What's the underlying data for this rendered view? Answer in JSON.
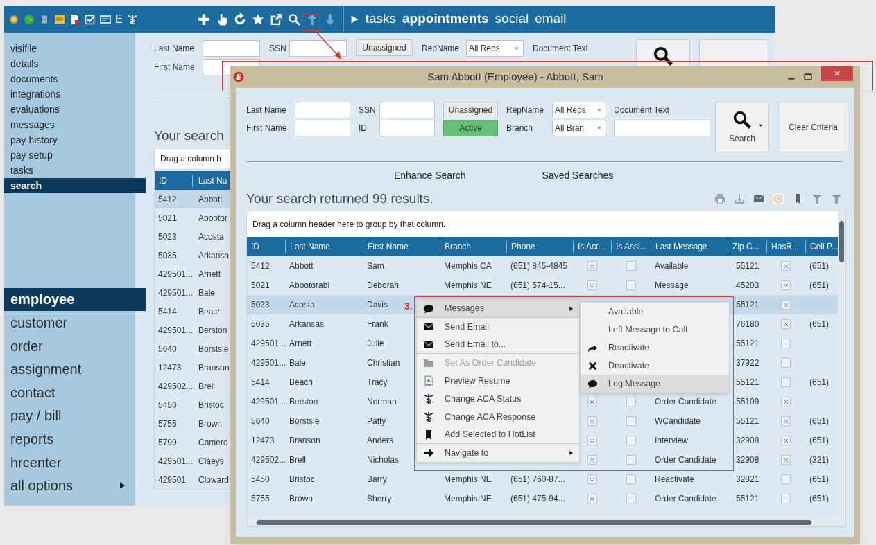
{
  "app": {
    "toolbar_letter": "E",
    "nav_links": [
      "tasks",
      "appointments",
      "social",
      "email"
    ],
    "sidebar_items": [
      {
        "label": "visifile",
        "selected": false
      },
      {
        "label": "details",
        "selected": false
      },
      {
        "label": "documents",
        "selected": false
      },
      {
        "label": "integrations",
        "selected": false
      },
      {
        "label": "evaluations",
        "selected": false
      },
      {
        "label": "messages",
        "selected": false
      },
      {
        "label": "pay history",
        "selected": false
      },
      {
        "label": "pay setup",
        "selected": false
      },
      {
        "label": "tasks",
        "selected": false
      },
      {
        "label": "search",
        "selected": true
      }
    ],
    "modules": [
      {
        "label": "employee",
        "selected": true,
        "submenu": false
      },
      {
        "label": "customer",
        "selected": false,
        "submenu": false
      },
      {
        "label": "order",
        "selected": false,
        "submenu": false
      },
      {
        "label": "assignment",
        "selected": false,
        "submenu": false
      },
      {
        "label": "contact",
        "selected": false,
        "submenu": false
      },
      {
        "label": "pay / bill",
        "selected": false,
        "submenu": false
      },
      {
        "label": "reports",
        "selected": false,
        "submenu": false
      },
      {
        "label": "hrcenter",
        "selected": false,
        "submenu": false
      },
      {
        "label": "all options",
        "selected": false,
        "submenu": true
      }
    ],
    "criteria": {
      "last_name_label": "Last Name",
      "first_name_label": "First Name",
      "ssn_label": "SSN",
      "unassigned_button": "Unassigned",
      "repname_label": "RepName",
      "repname_value": "All Reps",
      "document_text_label": "Document Text"
    },
    "results_heading": "Your search",
    "group_panel": "Drag a column h",
    "columns": [
      "ID",
      "Last Na"
    ],
    "rows": [
      {
        "id": "5412",
        "last_name": "Abbott",
        "selected": true
      },
      {
        "id": "5021",
        "last_name": "Abootor",
        "selected": false
      },
      {
        "id": "5023",
        "last_name": "Acosta",
        "selected": false
      },
      {
        "id": "5035",
        "last_name": "Arkansa",
        "selected": false
      },
      {
        "id": "429501...",
        "last_name": "Arnett",
        "selected": false
      },
      {
        "id": "429501...",
        "last_name": "Bale",
        "selected": false
      },
      {
        "id": "5414",
        "last_name": "Beach",
        "selected": false
      },
      {
        "id": "429501...",
        "last_name": "Berston",
        "selected": false
      },
      {
        "id": "5640",
        "last_name": "Borstsle",
        "selected": false
      },
      {
        "id": "12473",
        "last_name": "Branson",
        "selected": false
      },
      {
        "id": "429502...",
        "last_name": "Brell",
        "selected": false
      },
      {
        "id": "5450",
        "last_name": "Bristoc",
        "selected": false
      },
      {
        "id": "5755",
        "last_name": "Brown",
        "selected": false
      },
      {
        "id": "5799",
        "last_name": "Camero",
        "selected": false
      },
      {
        "id": "429501...",
        "last_name": "Claeys",
        "selected": false
      },
      {
        "id": "429501",
        "last_name": "Cloward",
        "selected": false
      }
    ]
  },
  "dialog": {
    "title": "Sam Abbott (Employee) - Abbott, Sam",
    "criteria": {
      "last_name_label": "Last Name",
      "first_name_label": "First Name",
      "ssn_label": "SSN",
      "id_label": "ID",
      "status_buttons": [
        {
          "label": "Unassigned",
          "selected": false
        },
        {
          "label": "Active",
          "selected": true
        }
      ],
      "repname_label": "RepName",
      "repname_value": "All Reps",
      "branch_label": "Branch",
      "branch_value": "All Bran",
      "document_text_label": "Document Text",
      "search_button": "Search",
      "clear_button": "Clear Criteria"
    },
    "links": [
      "Enhance Search",
      "Saved Searches"
    ],
    "results_heading": "Your search returned 99 results.",
    "group_panel": "Drag a column header here to group by that column.",
    "columns": [
      "ID",
      "Last Name",
      "First Name",
      "Branch",
      "Phone",
      "Is Acti...",
      "Is Assi...",
      "Last Message",
      "Zip C...",
      "HasR...",
      "Cell P..."
    ],
    "rows": [
      {
        "id": "5412",
        "last_name": "Abbott",
        "first_name": "Sam",
        "branch": "Memphis CA",
        "phone": "(651) 845-4845",
        "is_active": true,
        "is_assigned": false,
        "last_message": "Available",
        "zip": "55121",
        "has_r": true,
        "cell_phone": "(651)",
        "selected": false
      },
      {
        "id": "5021",
        "last_name": "Abootorabi",
        "first_name": "Deborah",
        "branch": "Memphis NE",
        "phone": "(651) 574-15...",
        "is_active": true,
        "is_assigned": false,
        "last_message": "Message",
        "zip": "45203",
        "has_r": true,
        "cell_phone": "(651)",
        "selected": false
      },
      {
        "id": "5023",
        "last_name": "Acosta",
        "first_name": "Davis",
        "zip": "55121",
        "has_r": true,
        "selected": true
      },
      {
        "id": "5035",
        "last_name": "Arkansas",
        "first_name": "Frank",
        "zip": "76180",
        "has_r": true,
        "cell_phone": "(651)",
        "selected": false
      },
      {
        "id": "429501...",
        "last_name": "Arnett",
        "first_name": "Julie",
        "zip": "55121",
        "has_r": false,
        "selected": false
      },
      {
        "id": "429501...",
        "last_name": "Bale",
        "first_name": "Christian",
        "zip": "37922",
        "has_r": false,
        "selected": false
      },
      {
        "id": "5414",
        "last_name": "Beach",
        "first_name": "Tracy",
        "zip": "55121",
        "has_r": false,
        "cell_phone": "(651)",
        "selected": false
      },
      {
        "id": "429501...",
        "last_name": "Berston",
        "first_name": "Norman",
        "is_active": true,
        "is_assigned": false,
        "last_message": "Order Candidate",
        "zip": "55109",
        "has_r": true,
        "selected": false
      },
      {
        "id": "5640",
        "last_name": "Borstsle",
        "first_name": "Patty",
        "is_active": true,
        "is_assigned": false,
        "last_message": "WCandidate",
        "zip": "55121",
        "has_r": true,
        "cell_phone": "(651)",
        "selected": false
      },
      {
        "id": "12473",
        "last_name": "Branson",
        "first_name": "Anders",
        "is_active": true,
        "is_assigned": false,
        "last_message": "Interview",
        "zip": "32908",
        "has_r": true,
        "cell_phone": "(651)",
        "selected": false
      },
      {
        "id": "429502...",
        "last_name": "Brell",
        "first_name": "Nicholas",
        "is_active": true,
        "is_assigned": false,
        "last_message": "Order Candidate",
        "zip": "32908",
        "has_r": true,
        "cell_phone": "(321)",
        "selected": false
      },
      {
        "id": "5450",
        "last_name": "Bristoc",
        "first_name": "Barry",
        "branch": "Memphis NE",
        "phone": "(651) 760-87...",
        "is_active": true,
        "is_assigned": false,
        "last_message": "Reactivate",
        "zip": "32821",
        "has_r": false,
        "cell_phone": "(651)",
        "selected": false
      },
      {
        "id": "5755",
        "last_name": "Brown",
        "first_name": "Sherry",
        "branch": "Memphis NE",
        "phone": "(651) 475-94...",
        "is_active": true,
        "is_assigned": false,
        "last_message": "Order Candidate",
        "zip": "55121",
        "has_r": false,
        "cell_phone": "(651)",
        "selected": false
      }
    ],
    "context_menu": [
      {
        "label": "Messages",
        "selected": true,
        "disabled": false,
        "submenu": true
      },
      {
        "label": "Send Email",
        "selected": false,
        "disabled": false,
        "submenu": false
      },
      {
        "label": "Send Email to...",
        "selected": false,
        "disabled": false,
        "submenu": false
      },
      {
        "label": "Set As Order Candidate",
        "selected": false,
        "disabled": true,
        "submenu": false
      },
      {
        "label": "Preview Resume",
        "selected": false,
        "disabled": false,
        "submenu": false
      },
      {
        "label": "Change ACA Status",
        "selected": false,
        "disabled": false,
        "submenu": false
      },
      {
        "label": "Change ACA Response",
        "selected": false,
        "disabled": false,
        "submenu": false
      },
      {
        "label": "Add Selected to HotList",
        "selected": false,
        "disabled": false,
        "submenu": false
      },
      {
        "label": "Navigate to",
        "selected": false,
        "disabled": false,
        "submenu": true
      }
    ],
    "submenu": [
      {
        "label": "Available",
        "selected": false
      },
      {
        "label": "Left Message to Call",
        "selected": false
      },
      {
        "label": "Reactivate",
        "selected": false
      },
      {
        "label": "Deactivate",
        "selected": false
      },
      {
        "label": "Log Message",
        "selected": true
      }
    ],
    "annotation_label": "3."
  }
}
